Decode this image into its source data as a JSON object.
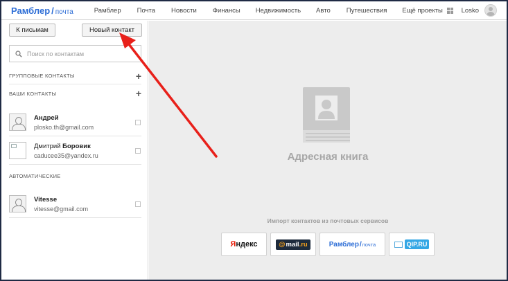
{
  "header": {
    "logo_brand": "Рамблер",
    "logo_slash": "/",
    "logo_service": "почта",
    "nav": [
      {
        "label": "Рамблер"
      },
      {
        "label": "Почта"
      },
      {
        "label": "Новости"
      },
      {
        "label": "Финансы"
      },
      {
        "label": "Недвижимость"
      },
      {
        "label": "Авто"
      },
      {
        "label": "Путешествия"
      },
      {
        "label": "Ещё проекты"
      }
    ],
    "username": "Losko"
  },
  "sidebar": {
    "back_button": "К письмам",
    "new_contact_button": "Новый контакт",
    "search_placeholder": "Поиск по контактам",
    "group_contacts_title": "ГРУППОВЫЕ КОНТАКТЫ",
    "your_contacts_title": "ВАШИ КОНТАКТЫ",
    "automatic_title": "АВТОМАТИЧЕСКИЕ",
    "plus_symbol": "+",
    "contacts": [
      {
        "first": "Андрей",
        "last": "",
        "email": "plosko.th@gmail.com"
      },
      {
        "first": "Дмитрий",
        "last": "Боровик",
        "email": "caducee35@yandex.ru"
      }
    ],
    "auto_contacts": [
      {
        "first": "Vitesse",
        "last": "",
        "email": "vitesse@gmail.com"
      }
    ]
  },
  "main": {
    "title": "Адресная книга",
    "import_caption": "Импорт контактов из почтовых сервисов",
    "services": {
      "yandex": {
        "first": "Я",
        "rest": "ндекс"
      },
      "mailru": {
        "at": "@",
        "name": "mail",
        "domain": ".ru"
      },
      "rambler": {
        "brand": "Рамблер",
        "slash": "/",
        "service": "почта"
      },
      "qip": {
        "label": "QIP.RU"
      }
    }
  },
  "colors": {
    "accent": "#2e6ed6",
    "annotation_arrow": "#e8201a",
    "main_bg": "#ededed"
  }
}
